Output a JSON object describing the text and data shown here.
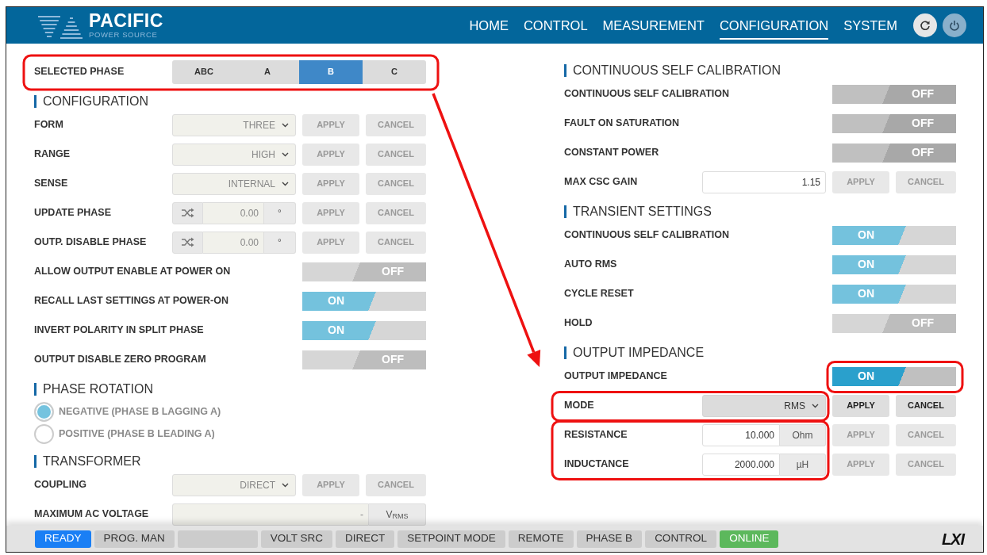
{
  "header": {
    "logo": {
      "name": "PACIFIC",
      "tagline": "POWER SOURCE"
    },
    "nav": [
      {
        "label": "HOME",
        "selected": false
      },
      {
        "label": "CONTROL",
        "selected": false
      },
      {
        "label": "MEASUREMENT",
        "selected": false
      },
      {
        "label": "CONFIGURATION",
        "selected": true
      },
      {
        "label": "SYSTEM",
        "selected": false
      }
    ],
    "buttons": [
      {
        "kind": "refresh"
      },
      {
        "kind": "power"
      }
    ]
  },
  "phase_selector": {
    "highlighted": true,
    "label": "SELECTED PHASE",
    "options": [
      {
        "label": "ABC",
        "selected": false
      },
      {
        "label": "A",
        "selected": false
      },
      {
        "label": "B",
        "selected": true
      },
      {
        "label": "C",
        "selected": false
      }
    ]
  },
  "left": [
    {
      "title": "CONFIGURATION",
      "rows": [
        {
          "kind": "select",
          "label": "FORM",
          "value": "THREE",
          "disabled": true,
          "actions": [
            {
              "label": "APPLY",
              "disabled": true
            },
            {
              "label": "CANCEL",
              "disabled": true
            }
          ]
        },
        {
          "kind": "select",
          "label": "RANGE",
          "value": "HIGH",
          "disabled": true,
          "actions": [
            {
              "label": "APPLY",
              "disabled": true
            },
            {
              "label": "CANCEL",
              "disabled": true
            }
          ]
        },
        {
          "kind": "select",
          "label": "SENSE",
          "value": "INTERNAL",
          "disabled": true,
          "actions": [
            {
              "label": "APPLY",
              "disabled": true
            },
            {
              "label": "CANCEL",
              "disabled": true
            }
          ]
        },
        {
          "kind": "phase",
          "label": "UPDATE PHASE",
          "value": "0.00",
          "unit": "°",
          "disabled": true,
          "actions": [
            {
              "label": "APPLY",
              "disabled": true
            },
            {
              "label": "CANCEL",
              "disabled": true
            }
          ]
        },
        {
          "kind": "phase",
          "label": "OUTP. DISABLE PHASE",
          "value": "0.00",
          "unit": "°",
          "disabled": true,
          "actions": [
            {
              "label": "APPLY",
              "disabled": true
            },
            {
              "label": "CANCEL",
              "disabled": true
            }
          ]
        },
        {
          "kind": "toggle",
          "label": "ALLOW OUTPUT ENABLE AT POWER ON",
          "on": false,
          "text": "OFF",
          "focused": false
        },
        {
          "kind": "toggle",
          "label": "RECALL LAST SETTINGS AT POWER-ON",
          "on": true,
          "text": "ON",
          "focused": false
        },
        {
          "kind": "toggle",
          "label": "INVERT POLARITY IN SPLIT PHASE",
          "on": true,
          "text": "ON",
          "focused": false
        },
        {
          "kind": "toggle",
          "label": "OUTPUT DISABLE ZERO PROGRAM",
          "on": false,
          "text": "OFF",
          "focused": false
        }
      ]
    },
    {
      "title": "PHASE ROTATION",
      "rows": [
        {
          "kind": "radio",
          "label": "NEGATIVE (PHASE B LAGGING A)",
          "selected": true,
          "disabled": true
        },
        {
          "kind": "radio",
          "label": "POSITIVE (PHASE B LEADING A)",
          "selected": false,
          "disabled": true
        }
      ]
    },
    {
      "title": "TRANSFORMER",
      "rows": [
        {
          "kind": "select",
          "label": "COUPLING",
          "value": "DIRECT",
          "disabled": true,
          "actions": [
            {
              "label": "APPLY",
              "disabled": true
            },
            {
              "label": "CANCEL",
              "disabled": true
            }
          ]
        },
        {
          "kind": "number",
          "label": "MAXIMUM AC VOLTAGE",
          "value": "-",
          "unit": "V$_{RMS}$",
          "disabled": true
        }
      ]
    }
  ],
  "right": [
    {
      "title": "CONTINUOUS SELF CALIBRATION",
      "rows": [
        {
          "kind": "toggle",
          "label": "CONTINUOUS SELF CALIBRATION",
          "on": false,
          "text": "OFF",
          "focused": true
        },
        {
          "kind": "toggle",
          "label": "FAULT ON SATURATION",
          "on": false,
          "text": "OFF",
          "focused": true
        },
        {
          "kind": "toggle",
          "label": "CONSTANT POWER",
          "on": false,
          "text": "OFF",
          "focused": true
        },
        {
          "kind": "number",
          "label": "MAX CSC GAIN",
          "value": "1.15",
          "disabled": false,
          "actions": [
            {
              "label": "APPLY",
              "disabled": true
            },
            {
              "label": "CANCEL",
              "disabled": true
            }
          ]
        }
      ]
    },
    {
      "title": "TRANSIENT SETTINGS",
      "rows": [
        {
          "kind": "toggle",
          "label": "CONTINUOUS SELF CALIBRATION",
          "on": true,
          "text": "ON",
          "focused": false
        },
        {
          "kind": "toggle",
          "label": "AUTO RMS",
          "on": true,
          "text": "ON",
          "focused": false
        },
        {
          "kind": "toggle",
          "label": "CYCLE RESET",
          "on": true,
          "text": "ON",
          "focused": false
        },
        {
          "kind": "toggle",
          "label": "HOLD",
          "on": false,
          "text": "OFF",
          "focused": false
        }
      ]
    },
    {
      "title": "OUTPUT IMPEDANCE",
      "rows": [
        {
          "kind": "toggle",
          "label": "OUTPUT IMPEDANCE",
          "on": true,
          "text": "ON",
          "focused": true,
          "highlighted": true,
          "outline_continues": false,
          "arrow_target": true
        },
        {
          "kind": "select",
          "label": "MODE",
          "value": "RMS",
          "disabled": false,
          "highlighted": true,
          "outline_continues": false,
          "arrow_target": false,
          "actions": [
            {
              "label": "APPLY",
              "disabled": false
            },
            {
              "label": "CANCEL",
              "disabled": false
            }
          ]
        },
        {
          "kind": "number",
          "label": "RESISTANCE",
          "value": "10.000",
          "unit": "Ohm",
          "disabled": false,
          "highlighted": true,
          "outline_continues": false,
          "arrow_target": false,
          "actions": [
            {
              "label": "APPLY",
              "disabled": true
            },
            {
              "label": "CANCEL",
              "disabled": true
            }
          ]
        },
        {
          "kind": "number",
          "label": "INDUCTANCE",
          "value": "2000.000",
          "unit": "µH",
          "disabled": false,
          "highlighted": true,
          "outline_continues": true,
          "arrow_target": false,
          "actions": [
            {
              "label": "APPLY",
              "disabled": true
            },
            {
              "label": "CANCEL",
              "disabled": true
            }
          ]
        }
      ]
    }
  ],
  "status_bar": {
    "items": [
      {
        "label": "READY",
        "color": "#1a7ff5"
      },
      {
        "label": "PROG. MAN",
        "color": "#cccccc"
      },
      {
        "color": "#cccccc"
      },
      {
        "label": "VOLT SRC",
        "color": "#cccccc"
      },
      {
        "label": "DIRECT",
        "color": "#cccccc"
      },
      {
        "label": "SETPOINT MODE",
        "color": "#cccccc"
      },
      {
        "label": "REMOTE",
        "color": "#cccccc"
      },
      {
        "label": "PHASE B",
        "color": "#cccccc"
      },
      {
        "label": "CONTROL",
        "color": "#cccccc"
      },
      {
        "label": "ONLINE",
        "color": "#5cb85c"
      }
    ],
    "logo": "LXI"
  }
}
